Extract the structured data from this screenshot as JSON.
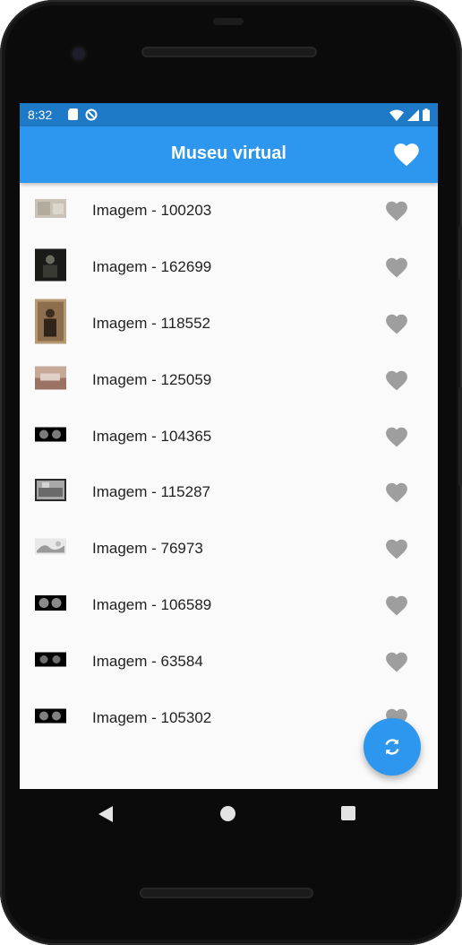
{
  "status_bar": {
    "time": "8:32"
  },
  "app_bar": {
    "title": "Museu virtual"
  },
  "list": {
    "items": [
      {
        "label": "Imagem - 100203",
        "thumb": "beige"
      },
      {
        "label": "Imagem - 162699",
        "thumb": "dark-portrait"
      },
      {
        "label": "Imagem - 118552",
        "thumb": "sepia-portrait"
      },
      {
        "label": "Imagem - 125059",
        "thumb": "sepia-landscape"
      },
      {
        "label": "Imagem - 104365",
        "thumb": "stereo"
      },
      {
        "label": "Imagem - 115287",
        "thumb": "grey-scene"
      },
      {
        "label": "Imagem - 76973",
        "thumb": "light-scene"
      },
      {
        "label": "Imagem - 106589",
        "thumb": "stereo"
      },
      {
        "label": "Imagem - 63584",
        "thumb": "stereo"
      },
      {
        "label": "Imagem - 105302",
        "thumb": "stereo"
      }
    ]
  },
  "colors": {
    "app_bar": "#2d96ee",
    "status_bar": "#1e7ac7",
    "heart_inactive": "#9e9e9e",
    "fab": "#2d96ee"
  },
  "icons": {
    "app_bar_action": "heart-icon",
    "row_action": "heart-icon",
    "fab": "refresh-icon"
  }
}
